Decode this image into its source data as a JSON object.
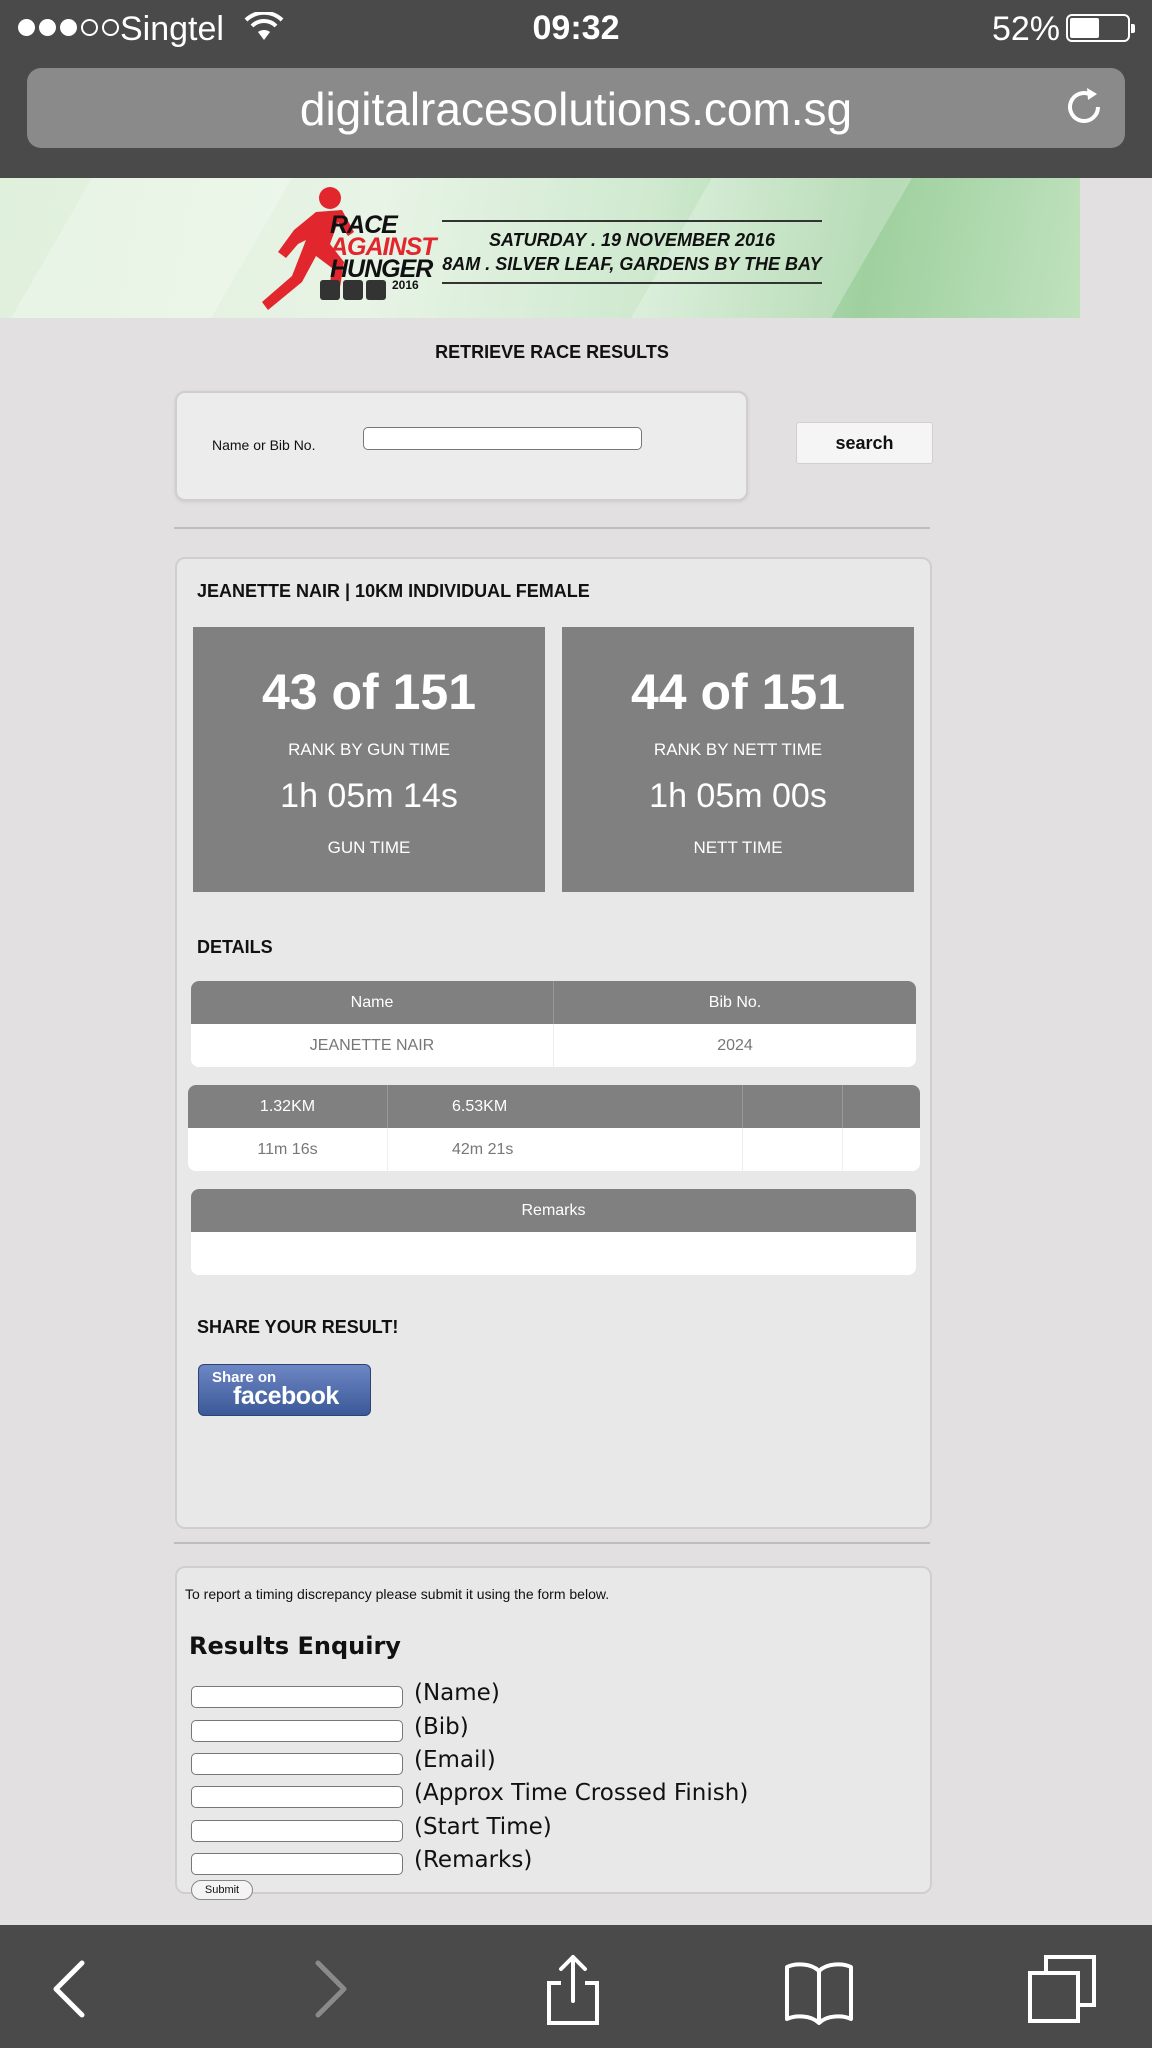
{
  "status_bar": {
    "carrier": "Singtel",
    "time": "09:32",
    "battery_percent": "52%",
    "battery_level": 0.52,
    "signal_bars_filled": 3,
    "signal_bars_total": 5
  },
  "browser": {
    "url": "digitalracesolutions.com.sg"
  },
  "banner": {
    "logo_line1": "RACE",
    "logo_line2": "AGAINST",
    "logo_line3": "HUNGER",
    "logo_year": "2016",
    "date_line": "SATURDAY . 19 NOVEMBER 2016",
    "venue_line": "8AM . SILVER LEAF,  GARDENS BY THE BAY",
    "brand_color": "#e2262d"
  },
  "search": {
    "title": "RETRIEVE RACE RESULTS",
    "label": "Name or Bib No.",
    "value": "",
    "button_label": "search"
  },
  "result": {
    "heading": "JEANETTE NAIR | 10KM INDIVIDUAL FEMALE",
    "gun": {
      "rank": "43 of 151",
      "rank_label": "RANK BY GUN TIME",
      "time": "1h 05m 14s",
      "time_label": "GUN TIME"
    },
    "nett": {
      "rank": "44 of 151",
      "rank_label": "RANK BY NETT TIME",
      "time": "1h 05m 00s",
      "time_label": "NETT TIME"
    },
    "details_heading": "DETAILS",
    "details_table": {
      "headers": [
        "Name",
        "Bib No."
      ],
      "row": [
        "JEANETTE NAIR",
        "2024"
      ]
    },
    "splits_table": {
      "headers": [
        "1.32KM",
        "6.53KM",
        "",
        ""
      ],
      "row": [
        "11m 16s",
        "42m 21s",
        "",
        ""
      ]
    },
    "remarks_table": {
      "header": "Remarks",
      "value": ""
    },
    "share_heading": "SHARE YOUR RESULT!",
    "facebook_small": "Share on",
    "facebook_big": "facebook"
  },
  "enquiry": {
    "note": "To report a timing discrepancy please submit it using the form below.",
    "title": "Results Enquiry",
    "fields": [
      "(Name)",
      "(Bib)",
      "(Email)",
      "(Approx Time Crossed Finish)",
      "(Start Time)",
      "(Remarks)"
    ],
    "submit_label": "Submit"
  },
  "toolbar": {
    "icons": [
      "back-icon",
      "forward-icon",
      "share-icon",
      "bookmarks-icon",
      "tabs-icon"
    ]
  }
}
